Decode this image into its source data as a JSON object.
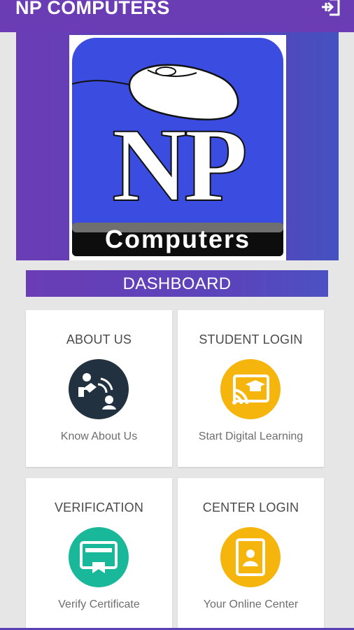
{
  "app": {
    "title": "NP COMPUTERS",
    "logout_icon": "logout-icon"
  },
  "logo": {
    "big_text": "NP",
    "sub_text": "Computers"
  },
  "dashboard": {
    "label": "DASHBOARD"
  },
  "cards": [
    {
      "title": "ABOUT US",
      "subtitle": "Know About Us",
      "icon": "about-icon",
      "color": "#22313f"
    },
    {
      "title": "STUDENT LOGIN",
      "subtitle": "Start Digital Learning",
      "icon": "cast-learning-icon",
      "color": "#f5b50c"
    },
    {
      "title": "VERIFICATION",
      "subtitle": "Verify Certificate",
      "icon": "certificate-icon",
      "color": "#19b89a"
    },
    {
      "title": "CENTER LOGIN",
      "subtitle": "Your Online Center",
      "icon": "center-user-icon",
      "color": "#f5b50c"
    }
  ],
  "colors": {
    "primary": "#6a3db5",
    "logo_blue": "#3b4de0"
  }
}
